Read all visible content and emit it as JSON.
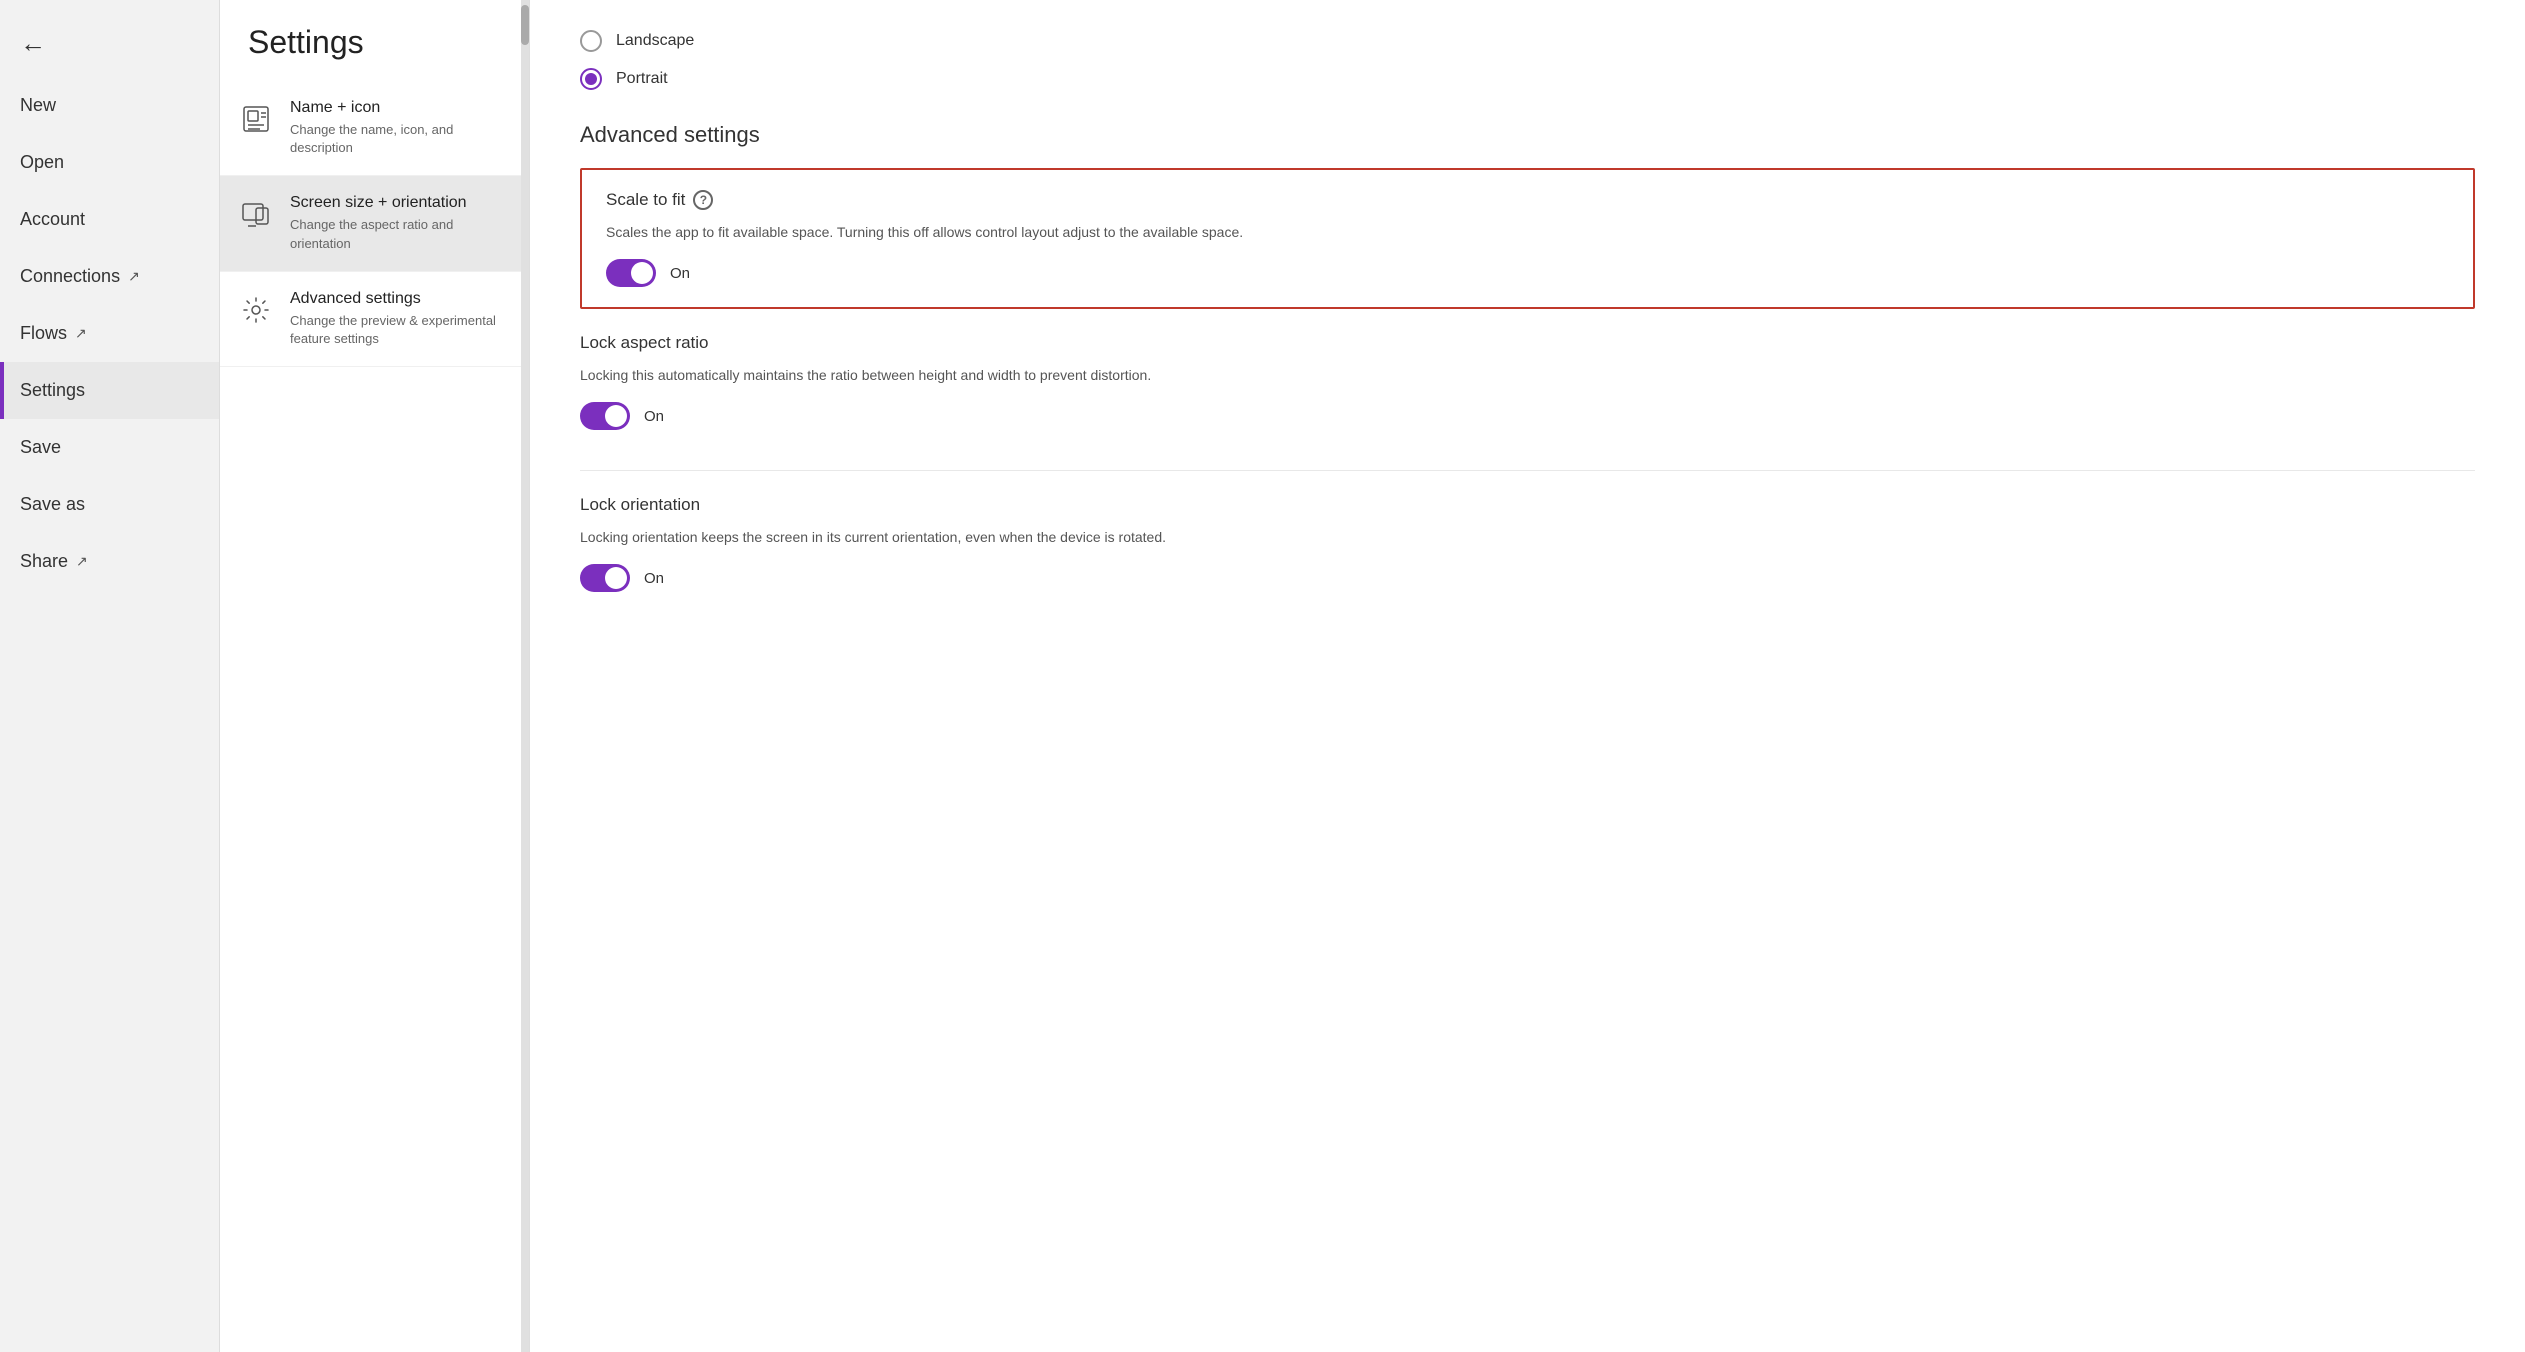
{
  "sidebar": {
    "back_icon": "←",
    "items": [
      {
        "id": "new",
        "label": "New",
        "active": false,
        "external": false
      },
      {
        "id": "open",
        "label": "Open",
        "active": false,
        "external": false
      },
      {
        "id": "account",
        "label": "Account",
        "active": false,
        "external": false
      },
      {
        "id": "connections",
        "label": "Connections",
        "active": false,
        "external": true
      },
      {
        "id": "flows",
        "label": "Flows",
        "active": false,
        "external": true
      },
      {
        "id": "settings",
        "label": "Settings",
        "active": true,
        "external": false
      },
      {
        "id": "save",
        "label": "Save",
        "active": false,
        "external": false
      },
      {
        "id": "save-as",
        "label": "Save as",
        "active": false,
        "external": false
      },
      {
        "id": "share",
        "label": "Share",
        "active": false,
        "external": true
      }
    ]
  },
  "middle": {
    "title": "Settings",
    "menu_items": [
      {
        "id": "name-icon",
        "title": "Name + icon",
        "desc": "Change the name, icon, and description",
        "selected": false,
        "icon": "name-icon-svg"
      },
      {
        "id": "screen-size",
        "title": "Screen size + orientation",
        "desc": "Change the aspect ratio and orientation",
        "selected": true,
        "icon": "screen-size-svg"
      },
      {
        "id": "advanced",
        "title": "Advanced settings",
        "desc": "Change the preview & experimental feature settings",
        "selected": false,
        "icon": "gear-svg"
      }
    ]
  },
  "right": {
    "landscape_label": "Landscape",
    "portrait_label": "Portrait",
    "portrait_selected": true,
    "landscape_selected": false,
    "advanced_section_title": "Advanced settings",
    "scale_to_fit": {
      "label": "Scale to fit",
      "desc": "Scales the app to fit available space. Turning this off allows control layout adjust to the available space.",
      "toggle_on": true,
      "toggle_label": "On"
    },
    "lock_aspect_ratio": {
      "label": "Lock aspect ratio",
      "desc": "Locking this automatically maintains the ratio between height and width to prevent distortion.",
      "toggle_on": true,
      "toggle_label": "On"
    },
    "lock_orientation": {
      "label": "Lock orientation",
      "desc": "Locking orientation keeps the screen in its current orientation, even when the device is rotated.",
      "toggle_on": true,
      "toggle_label": "On"
    }
  }
}
